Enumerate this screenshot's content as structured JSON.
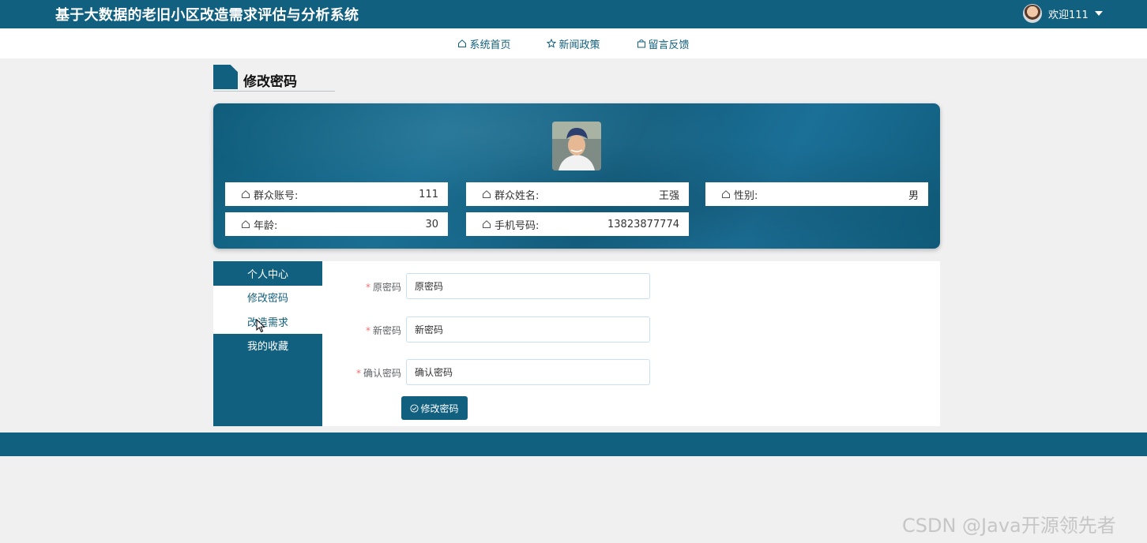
{
  "header": {
    "app_title": "基于大数据的老旧小区改造需求评估与分析系统",
    "welcome": "欢迎111"
  },
  "nav": {
    "items": [
      {
        "label": "系统首页",
        "icon": "home-icon"
      },
      {
        "label": "新闻政策",
        "icon": "star-icon"
      },
      {
        "label": "留言反馈",
        "icon": "bag-icon"
      }
    ]
  },
  "page": {
    "section_title": "修改密码"
  },
  "profile": {
    "fields": [
      {
        "label": "群众账号:",
        "value": "111"
      },
      {
        "label": "群众姓名:",
        "value": "王强"
      },
      {
        "label": "性别:",
        "value": "男"
      },
      {
        "label": "年龄:",
        "value": "30"
      },
      {
        "label": "手机号码:",
        "value": "13823877774"
      }
    ]
  },
  "side_menu": {
    "items": [
      {
        "label": "个人中心"
      },
      {
        "label": "修改密码"
      },
      {
        "label": "改造需求"
      },
      {
        "label": "我的收藏"
      }
    ]
  },
  "form": {
    "fields": [
      {
        "label": "原密码",
        "value": "原密码"
      },
      {
        "label": "新密码",
        "value": "新密码"
      },
      {
        "label": "确认密码",
        "value": "确认密码"
      }
    ],
    "submit_label": "修改密码"
  },
  "watermark": "CSDN @Java开源领先者",
  "colors": {
    "primary": "#12607f",
    "background": "#f0f0f1",
    "required": "#f56c6c"
  }
}
